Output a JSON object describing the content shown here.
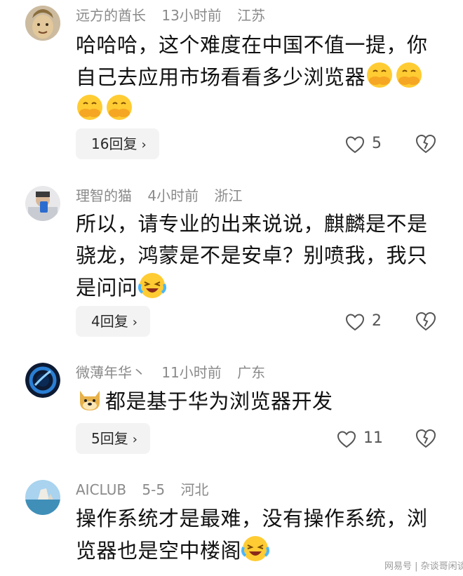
{
  "comments": [
    {
      "username": "远方的酋长",
      "time": "13小时前",
      "location": "江苏",
      "text_line1": "哈哈哈，这个难度在中国不值一提，你",
      "text_line2": "自己去应用市场看看多少浏览器",
      "reply_label": "16回复",
      "likes": "5",
      "emojis": [
        "cover-mouth-emoji",
        "cover-mouth-emoji",
        "cover-mouth-emoji",
        "cover-mouth-emoji"
      ]
    },
    {
      "username": "理智的猫",
      "time": "4小时前",
      "location": "浙江",
      "text_line1": "所以，请专业的出来说说，麒麟是不是",
      "text_line2": "骁龙，鸿蒙是不是安卓？别喷我，我只",
      "text_line3": "是问问",
      "reply_label": "4回复",
      "likes": "2",
      "emojis": [
        "laugh-cry-emoji"
      ]
    },
    {
      "username": "微薄年华丶",
      "time": "11小时前",
      "location": "广东",
      "text_line1": "都是基于华为浏览器开发",
      "reply_label": "5回复",
      "likes": "11",
      "emojis": [
        "doge-emoji"
      ]
    },
    {
      "username": "AICLUB",
      "time": "5-5",
      "location": "河北",
      "text_line1": "操作系统才是最难，没有操作系统，浏",
      "text_line2": "览器也是空中楼阁",
      "emojis": [
        "laugh-cry-emoji"
      ]
    }
  ],
  "chevron": "›",
  "watermark": "网易号 | 杂谈哥闲谈",
  "colors": {
    "meta": "#8a8a8a",
    "text": "#111111",
    "pill_bg": "#f3f3f3",
    "icon": "#555555"
  }
}
